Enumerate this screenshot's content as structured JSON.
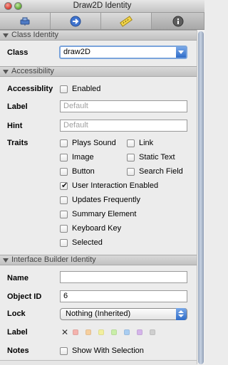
{
  "window": {
    "title": "Draw2D Identity"
  },
  "toolbar": {
    "tabs": [
      "attributes-inspector-icon",
      "connections-inspector-icon",
      "size-inspector-icon",
      "identity-inspector-icon"
    ]
  },
  "class_identity": {
    "header": "Class Identity",
    "class_label": "Class",
    "class_value": "draw2D"
  },
  "accessibility": {
    "header": "Accessibility",
    "accessibility_label": "Accessiblity",
    "enabled_label": "Enabled",
    "label_label": "Label",
    "label_placeholder": "Default",
    "hint_label": "Hint",
    "hint_placeholder": "Default",
    "traits_label": "Traits",
    "traits_left": [
      {
        "label": "Plays Sound",
        "checked": false
      },
      {
        "label": "Image",
        "checked": false
      },
      {
        "label": "Button",
        "checked": false
      },
      {
        "label": "User Interaction Enabled",
        "checked": true
      },
      {
        "label": "Updates Frequently",
        "checked": false
      },
      {
        "label": "Summary Element",
        "checked": false
      },
      {
        "label": "Keyboard Key",
        "checked": false
      },
      {
        "label": "Selected",
        "checked": false
      }
    ],
    "traits_right": [
      {
        "label": "Link",
        "checked": false
      },
      {
        "label": "Static Text",
        "checked": false
      },
      {
        "label": "Search Field",
        "checked": false
      }
    ]
  },
  "ib_identity": {
    "header": "Interface Builder Identity",
    "name_label": "Name",
    "name_value": "",
    "object_id_label": "Object ID",
    "object_id_value": "6",
    "lock_label": "Lock",
    "lock_value": "Nothing (Inherited)",
    "label_label": "Label",
    "label_colors": [
      "#f4b3ae",
      "#f6cf9e",
      "#f2ef9e",
      "#c9eea8",
      "#a9cdf1",
      "#d5b5ea",
      "#cfcfcf"
    ],
    "notes_label": "Notes",
    "show_with_selection_label": "Show With Selection"
  },
  "colors": {
    "accent": "#3d78d8",
    "section_header": "#cfcfcf"
  }
}
